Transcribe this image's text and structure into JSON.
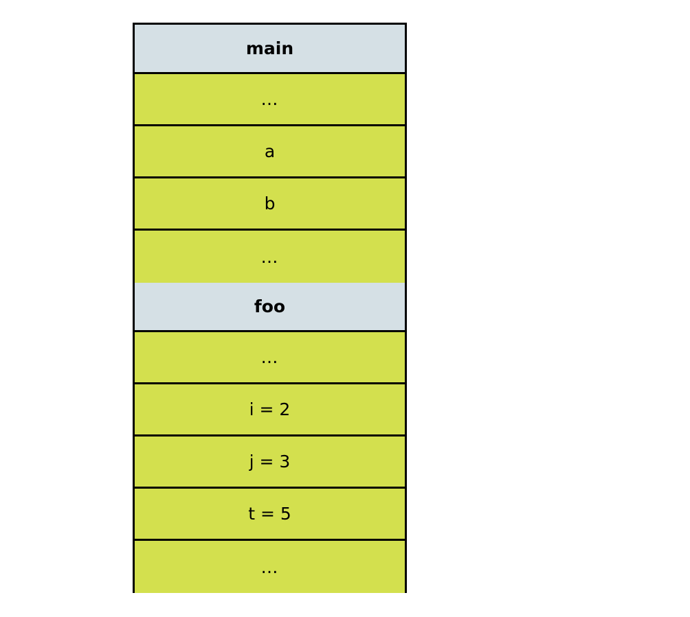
{
  "diagram": {
    "title": "call-stack-frames",
    "colors": {
      "header_fill": "#d5e0e5",
      "slot_fill": "#d3e04e",
      "border": "#000000",
      "text": "#000000",
      "background": "#ffffff"
    },
    "frames": [
      {
        "name": "main",
        "header_label": "main",
        "rows": [
          {
            "label": "…",
            "kind": "ellipsis"
          },
          {
            "label": "a",
            "kind": "variable"
          },
          {
            "label": "b",
            "kind": "variable"
          },
          {
            "label": "…",
            "kind": "ellipsis"
          }
        ]
      },
      {
        "name": "foo",
        "header_label": "foo",
        "rows": [
          {
            "label": "…",
            "kind": "ellipsis"
          },
          {
            "label": "i = 2",
            "kind": "variable"
          },
          {
            "label": "j = 3",
            "kind": "variable"
          },
          {
            "label": "t = 5",
            "kind": "variable"
          },
          {
            "label": "…",
            "kind": "ellipsis"
          }
        ]
      }
    ]
  }
}
